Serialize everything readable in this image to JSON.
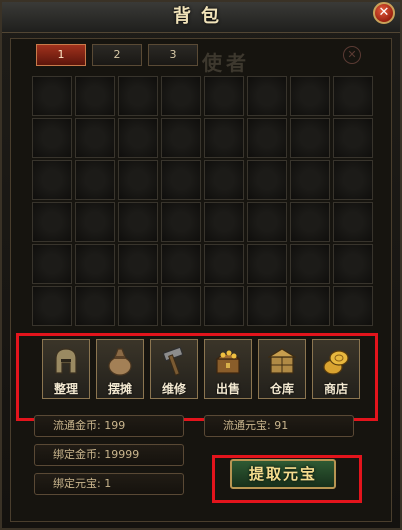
{
  "window": {
    "title": "背包"
  },
  "tabs": [
    {
      "label": "1",
      "active": true
    },
    {
      "label": "2",
      "active": false
    },
    {
      "label": "3",
      "active": false
    }
  ],
  "background_text": "使者",
  "grid": {
    "rows": 6,
    "columns": 8,
    "occupied": 0
  },
  "actions": [
    {
      "label": "整理",
      "icon": "helmet-icon"
    },
    {
      "label": "摆摊",
      "icon": "money-bag-icon"
    },
    {
      "label": "维修",
      "icon": "hammer-icon"
    },
    {
      "label": "出售",
      "icon": "treasure-chest-icon"
    },
    {
      "label": "仓库",
      "icon": "warehouse-icon"
    },
    {
      "label": "商店",
      "icon": "coins-icon"
    }
  ],
  "currency": {
    "circulating_gold": "流通金币: 199",
    "circulating_ingot": "流通元宝: 91",
    "bound_gold": "绑定金币: 19999",
    "bound_ingot": "绑定元宝: 1"
  },
  "redeem_button": {
    "label": "提取元宝"
  },
  "colors": {
    "highlight": "#e3141c",
    "accent_gold": "#c9a25a",
    "active_tab": "#a1321d"
  }
}
